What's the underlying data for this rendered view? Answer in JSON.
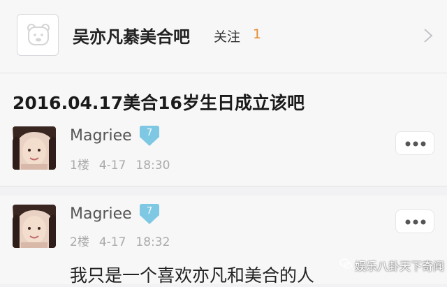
{
  "forum": {
    "name": "吴亦凡綦美合吧",
    "follow_label": "关注",
    "follow_count": "1",
    "icon": "bear-face-icon"
  },
  "thread": {
    "title": "2016.04.17美合16岁生日成立该吧"
  },
  "posts": [
    {
      "username": "Magriee",
      "level": "7",
      "floor": "1楼",
      "date": "4-17",
      "time": "18:30",
      "more": "more-icon"
    },
    {
      "username": "Magriee",
      "level": "7",
      "floor": "2楼",
      "date": "4-17",
      "time": "18:32",
      "more": "more-icon",
      "content": "我只是一个喜欢亦凡和美合的人"
    }
  ],
  "watermark": {
    "text": "娱乐八卦天下奇闻"
  },
  "colors": {
    "badge": "#7ec8e3",
    "follow_count": "#e58b2c",
    "background": "#f7f7f8"
  }
}
